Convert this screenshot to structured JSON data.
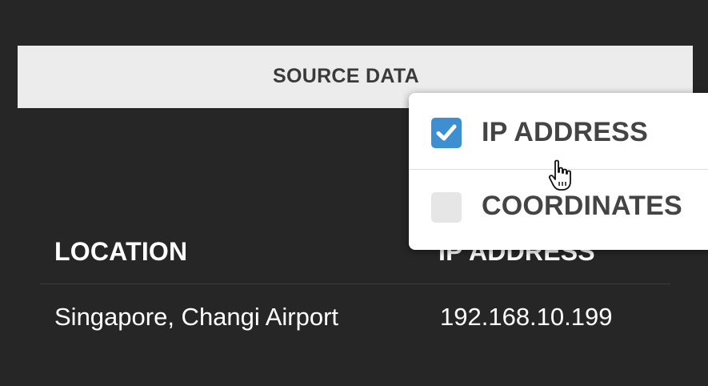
{
  "source_button": {
    "label": "SOURCE DATA"
  },
  "dropdown": {
    "items": [
      {
        "label": "IP ADDRESS",
        "checked": true
      },
      {
        "label": "COORDINATES",
        "checked": false
      }
    ]
  },
  "table": {
    "headers": [
      "LOCATION",
      "IP ADDRESS"
    ],
    "rows": [
      {
        "location": "Singapore, Changi Airport",
        "ip": "192.168.10.199"
      }
    ]
  },
  "colors": {
    "background": "#262626",
    "button_bg": "#ececec",
    "checkbox_checked": "#3d8fd1",
    "checkbox_unchecked": "#e6e6e6"
  },
  "icons": {
    "checkmark": "checkmark-icon",
    "cursor": "hand-pointer-icon"
  }
}
